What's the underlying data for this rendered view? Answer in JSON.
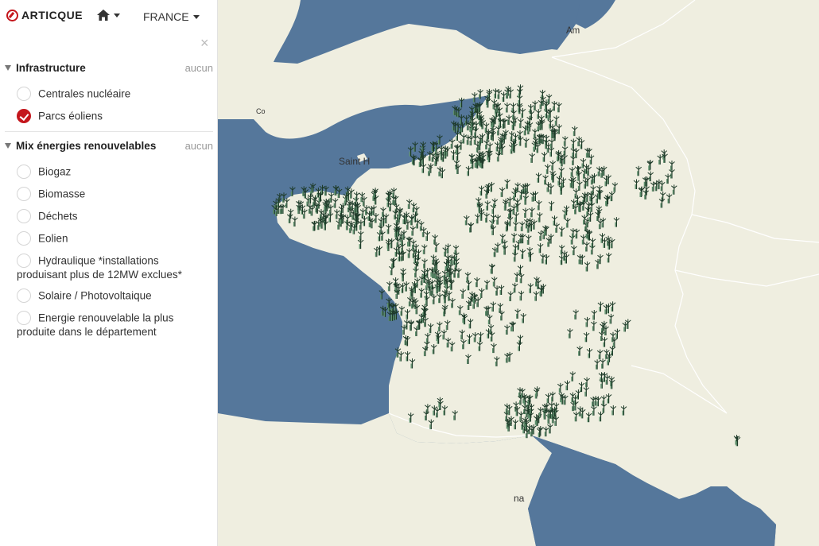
{
  "header": {
    "logo_text": "ARTICQUE",
    "country_label": "FRANCE",
    "home_icon": "home-icon",
    "close_icon": "close-icon"
  },
  "sections": [
    {
      "title": "Infrastructure",
      "action": "aucun",
      "options": [
        {
          "label": "Centrales nucléaire",
          "checked": false
        },
        {
          "label": "Parcs éoliens",
          "checked": true
        }
      ]
    },
    {
      "title": "Mix énergies renouvelables",
      "action": "aucun",
      "options": [
        {
          "label": "Biogaz",
          "checked": false
        },
        {
          "label": "Biomasse",
          "checked": false
        },
        {
          "label": "Déchets",
          "checked": false
        },
        {
          "label": "Eolien",
          "checked": false
        },
        {
          "label": "Hydraulique *installations produisant plus de 12MW exclues*",
          "checked": false
        },
        {
          "label": "Solaire / Photovoltaique",
          "checked": false
        },
        {
          "label": "Energie renouvelable la plus produite dans le département",
          "checked": false
        }
      ]
    }
  ],
  "map": {
    "labels": {
      "amsterdam": "Am",
      "saint_helier": "Saint H",
      "corsica_partial": "na",
      "cornwall_partial": "Co"
    },
    "colors": {
      "sea": "#55779b",
      "land": "#efeee0",
      "border": "#ffffff",
      "marker": "#2f5a3e",
      "accent": "#c4161c"
    },
    "marker_icon": "wind-turbine-icon"
  }
}
